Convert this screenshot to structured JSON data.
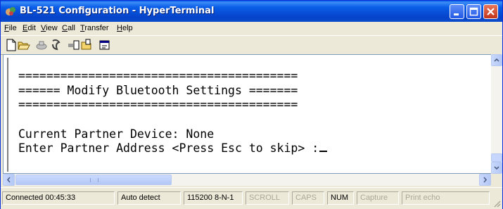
{
  "window": {
    "title": "BL-521 Configuration - HyperTerminal"
  },
  "menu": {
    "items": [
      "File",
      "Edit",
      "View",
      "Call",
      "Transfer",
      "Help"
    ]
  },
  "terminal": {
    "lines": [
      "========================================",
      "====== Modify Bluetooth Settings =======",
      "========================================",
      "",
      "Current Partner Device: None",
      "Enter Partner Address <Press Esc to skip> :"
    ]
  },
  "status": {
    "connected": "Connected 00:45:33",
    "detect": "Auto detect",
    "settings": "115200 8-N-1",
    "scroll": "SCROLL",
    "caps": "CAPS",
    "num": "NUM",
    "capture": "Capture",
    "print_echo": "Print echo"
  },
  "colors": {
    "titlebar": "#0a5fe8",
    "chrome": "#ece9d8",
    "terminal_bg": "#ffffff"
  }
}
